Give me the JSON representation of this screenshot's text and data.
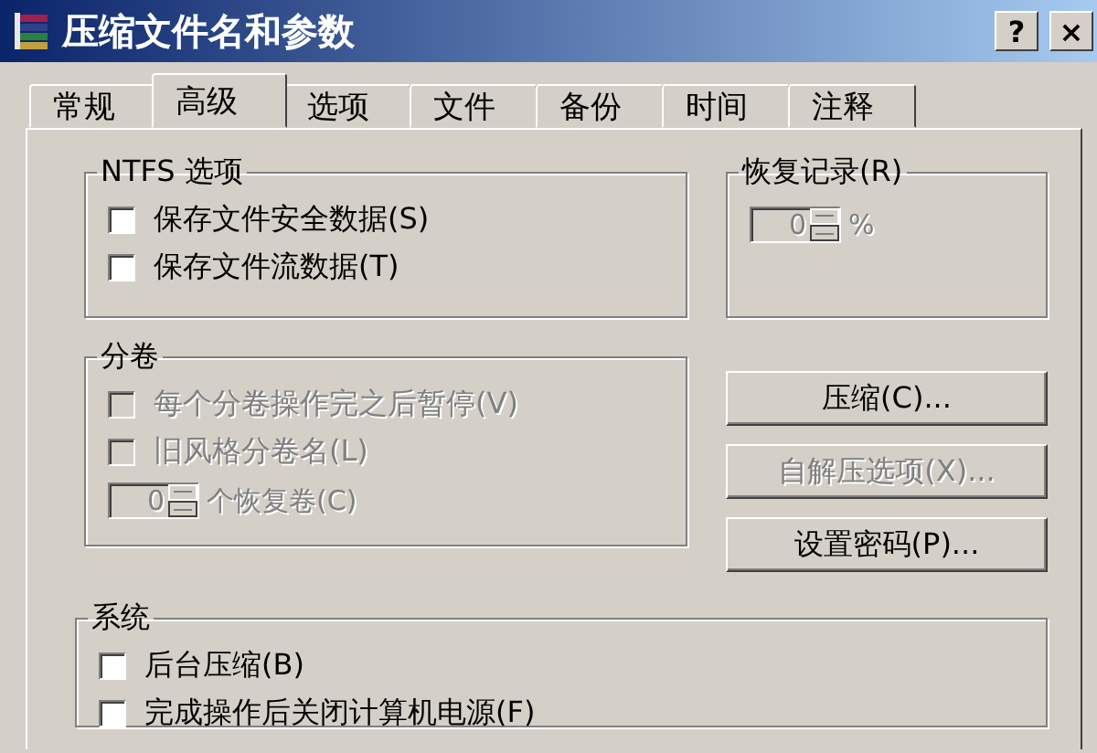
{
  "window": {
    "title": "压缩文件名和参数",
    "help_button": "?",
    "close_button": "×"
  },
  "tabs": [
    {
      "label": "常规",
      "selected": false
    },
    {
      "label": "高级",
      "selected": true
    },
    {
      "label": "选项",
      "selected": false
    },
    {
      "label": "文件",
      "selected": false
    },
    {
      "label": "备份",
      "selected": false
    },
    {
      "label": "时间",
      "selected": false
    },
    {
      "label": "注释",
      "selected": false
    }
  ],
  "ntfs": {
    "title": "NTFS 选项",
    "options": [
      {
        "label": "保存文件安全数据(S)",
        "checked": false,
        "disabled": false
      },
      {
        "label": "保存文件流数据(T)",
        "checked": false,
        "disabled": false
      }
    ]
  },
  "recovery": {
    "title": "恢复记录(R)",
    "value": "0",
    "unit": "%",
    "disabled": true
  },
  "volumes": {
    "title": "分卷",
    "options": [
      {
        "label": "每个分卷操作完之后暂停(V)",
        "checked": false,
        "disabled": true
      },
      {
        "label": "旧风格分卷名(L)",
        "checked": false,
        "disabled": true
      }
    ],
    "spinner": {
      "value": "0",
      "label": "个恢复卷(C)",
      "disabled": true
    }
  },
  "buttons": [
    {
      "label": "压缩(C)...",
      "disabled": false
    },
    {
      "label": "自解压选项(X)...",
      "disabled": true
    },
    {
      "label": "设置密码(P)...",
      "disabled": false
    }
  ],
  "system": {
    "title": "系统",
    "options": [
      {
        "label": "后台压缩(B)",
        "checked": false,
        "disabled": false
      },
      {
        "label": "完成操作后关闭计算机电源(F)",
        "checked": false,
        "disabled": false
      }
    ]
  }
}
